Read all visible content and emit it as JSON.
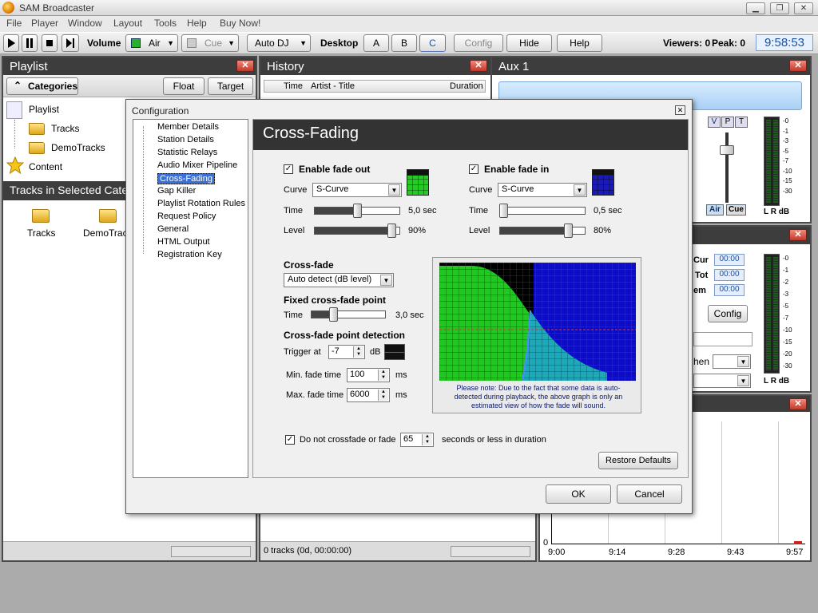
{
  "app": {
    "title": "SAM Broadcaster",
    "win_min": "▁",
    "win_restore": "❐",
    "win_close": "✕"
  },
  "menu": [
    "File",
    "Player",
    "Window",
    "Layout",
    "Tools",
    "Help",
    "Buy Now!"
  ],
  "toolbar": {
    "volume_label": "Volume",
    "air_label": "Air",
    "cue_label": "Cue",
    "autodj_label": "Auto DJ",
    "desktop_label": "Desktop",
    "desktops": [
      "A",
      "B",
      "C"
    ],
    "config_label": "Config",
    "hide_label": "Hide",
    "help_label": "Help",
    "viewers": "Viewers: 0",
    "peak": "Peak: 0",
    "clock": "9:58:53"
  },
  "playlist": {
    "title": "Playlist",
    "categories_label": "Categories",
    "float_label": "Float",
    "target_label": "Target",
    "tree": [
      "Playlist",
      "Tracks",
      "DemoTracks",
      "Content"
    ],
    "tracks_header": "Tracks in Selected Catego",
    "icons": [
      "Tracks",
      "DemoTrack"
    ]
  },
  "history": {
    "title": "History",
    "columns": [
      "Time",
      "Artist - Title",
      "Duration"
    ],
    "status": "0 tracks (0d, 00:00:00)"
  },
  "aux1": {
    "title": "Aux 1",
    "vpt": [
      "V",
      "P",
      "T"
    ],
    "air_label": "Air",
    "cue_label": "Cue",
    "db_label": "L R dB",
    "scale": [
      "-0",
      "-1",
      "-3",
      "-5",
      "-7",
      "-10",
      "-15",
      "-30"
    ]
  },
  "deck": {
    "cur_label": "Cur",
    "tot_label": "Tot",
    "rem_label": "em",
    "cur": "00:00",
    "tot": "00:00",
    "rem": "00:00",
    "config_label": "Config",
    "then_label": "hen",
    "db_label": "L R dB",
    "scale": [
      "-0",
      "-1",
      "-2",
      "-3",
      "-5",
      "-7",
      "-10",
      "-15",
      "-20",
      "-30"
    ]
  },
  "graph": {
    "y_zero": "0",
    "x_ticks": [
      "9:00",
      "9:14",
      "9:28",
      "9:43",
      "9:57"
    ]
  },
  "dialog": {
    "title": "Configuration",
    "close": "✕",
    "nav": [
      "Member Details",
      "Station Details",
      "Statistic Relays",
      "Audio Mixer Pipeline",
      "Cross-Fading",
      "Gap Killer",
      "Playlist Rotation Rules",
      "Request Policy",
      "General",
      "HTML Output",
      "Registration Key"
    ],
    "nav_selected": 4,
    "heading": "Cross-Fading",
    "fade_out": {
      "label": "Enable fade out",
      "checked": "✓",
      "curve_label": "Curve",
      "curve": "S-Curve",
      "time_label": "Time",
      "time_value": "5,0 sec",
      "time_level": 0.5,
      "level_label": "Level",
      "level_value": "90%",
      "level": 0.9,
      "color": "#22cc22"
    },
    "fade_in": {
      "label": "Enable fade in",
      "checked": "✓",
      "curve_label": "Curve",
      "curve": "S-Curve",
      "time_label": "Time",
      "time_value": "0,5 sec",
      "time_level": 0.05,
      "level_label": "Level",
      "level_value": "80%",
      "level": 0.8,
      "color": "#1a1ab8"
    },
    "crossfade": {
      "label": "Cross-fade",
      "mode": "Auto detect (dB level)"
    },
    "fixed": {
      "label": "Fixed cross-fade point",
      "time_label": "Time",
      "time_value": "3,0 sec",
      "time_level": 0.3
    },
    "detection": {
      "label": "Cross-fade point detection",
      "trigger_label": "Trigger at",
      "trigger": "-7",
      "db": "dB",
      "min_label": "Min. fade time",
      "min": "100",
      "ms1": "ms",
      "max_label": "Max. fade time",
      "max": "6000",
      "ms2": "ms"
    },
    "note": "Please note: Due to the fact that some data is auto-detected during playback, the above graph is only an estimated view of how the fade will sound.",
    "no_crossfade": {
      "checked": "✓",
      "label": "Do not crossfade or fade",
      "value": "65",
      "suffix": "seconds or less in duration"
    },
    "restore_label": "Restore Defaults",
    "ok_label": "OK",
    "cancel_label": "Cancel"
  }
}
